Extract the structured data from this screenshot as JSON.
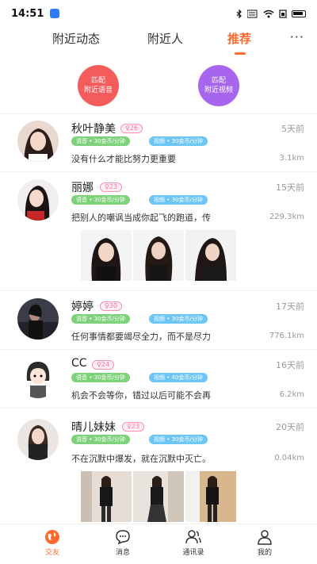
{
  "status_bar": {
    "time": "14:51"
  },
  "tabs": [
    {
      "label": "附近动态"
    },
    {
      "label": "附近人"
    },
    {
      "label": "推荐"
    }
  ],
  "more_label": "···",
  "match": {
    "voice": {
      "line1": "匹配",
      "line2": "附近语音"
    },
    "video": {
      "line1": "匹配",
      "line2": "附近视频"
    }
  },
  "feed": [
    {
      "name": "秋叶静美",
      "age": "♀26",
      "time": "5天前",
      "voice": "语音 • 30金币/分钟",
      "video": "视频 • 30金币/分钟",
      "text": "没有什么才能比努力更重要",
      "dist": "3.1km"
    },
    {
      "name": "丽娜",
      "age": "♀23",
      "time": "15天前",
      "voice": "语音 • 30金币/分钟",
      "video": "视频 • 30金币/分钟",
      "text": "把别人的嘲讽当成你起飞的跑道，传",
      "dist": "229.3km"
    },
    {
      "name": "婷婷",
      "age": "♀30",
      "time": "17天前",
      "voice": "语音 • 30金币/分钟",
      "video": "视频 • 30金币/分钟",
      "text": "任何事情都要竭尽全力，而不是尽力",
      "dist": "776.1km"
    },
    {
      "name": "CC",
      "age": "♀24",
      "time": "16天前",
      "voice": "语音 • 30金币/分钟",
      "video": "视频 • 40金币/分钟",
      "text": "机会不会等你，错过以后可能不会再",
      "dist": "6.2km"
    },
    {
      "name": "晴儿妹妹",
      "age": "♀23",
      "time": "20天前",
      "voice": "语音 • 30金币/分钟",
      "video": "视频 • 30金币/分钟",
      "text": "不在沉默中爆发，就在沉默中灭亡。",
      "dist": "0.04km"
    }
  ],
  "nav": [
    {
      "label": "交友"
    },
    {
      "label": "消息"
    },
    {
      "label": "通讯录"
    },
    {
      "label": "我的"
    }
  ],
  "colors": {
    "accent": "#ff6a2e",
    "voice_pill": "#7fd27c",
    "video_pill": "#6ec6f5",
    "match_voice": "#f45b5b",
    "match_video": "#a765ee"
  }
}
